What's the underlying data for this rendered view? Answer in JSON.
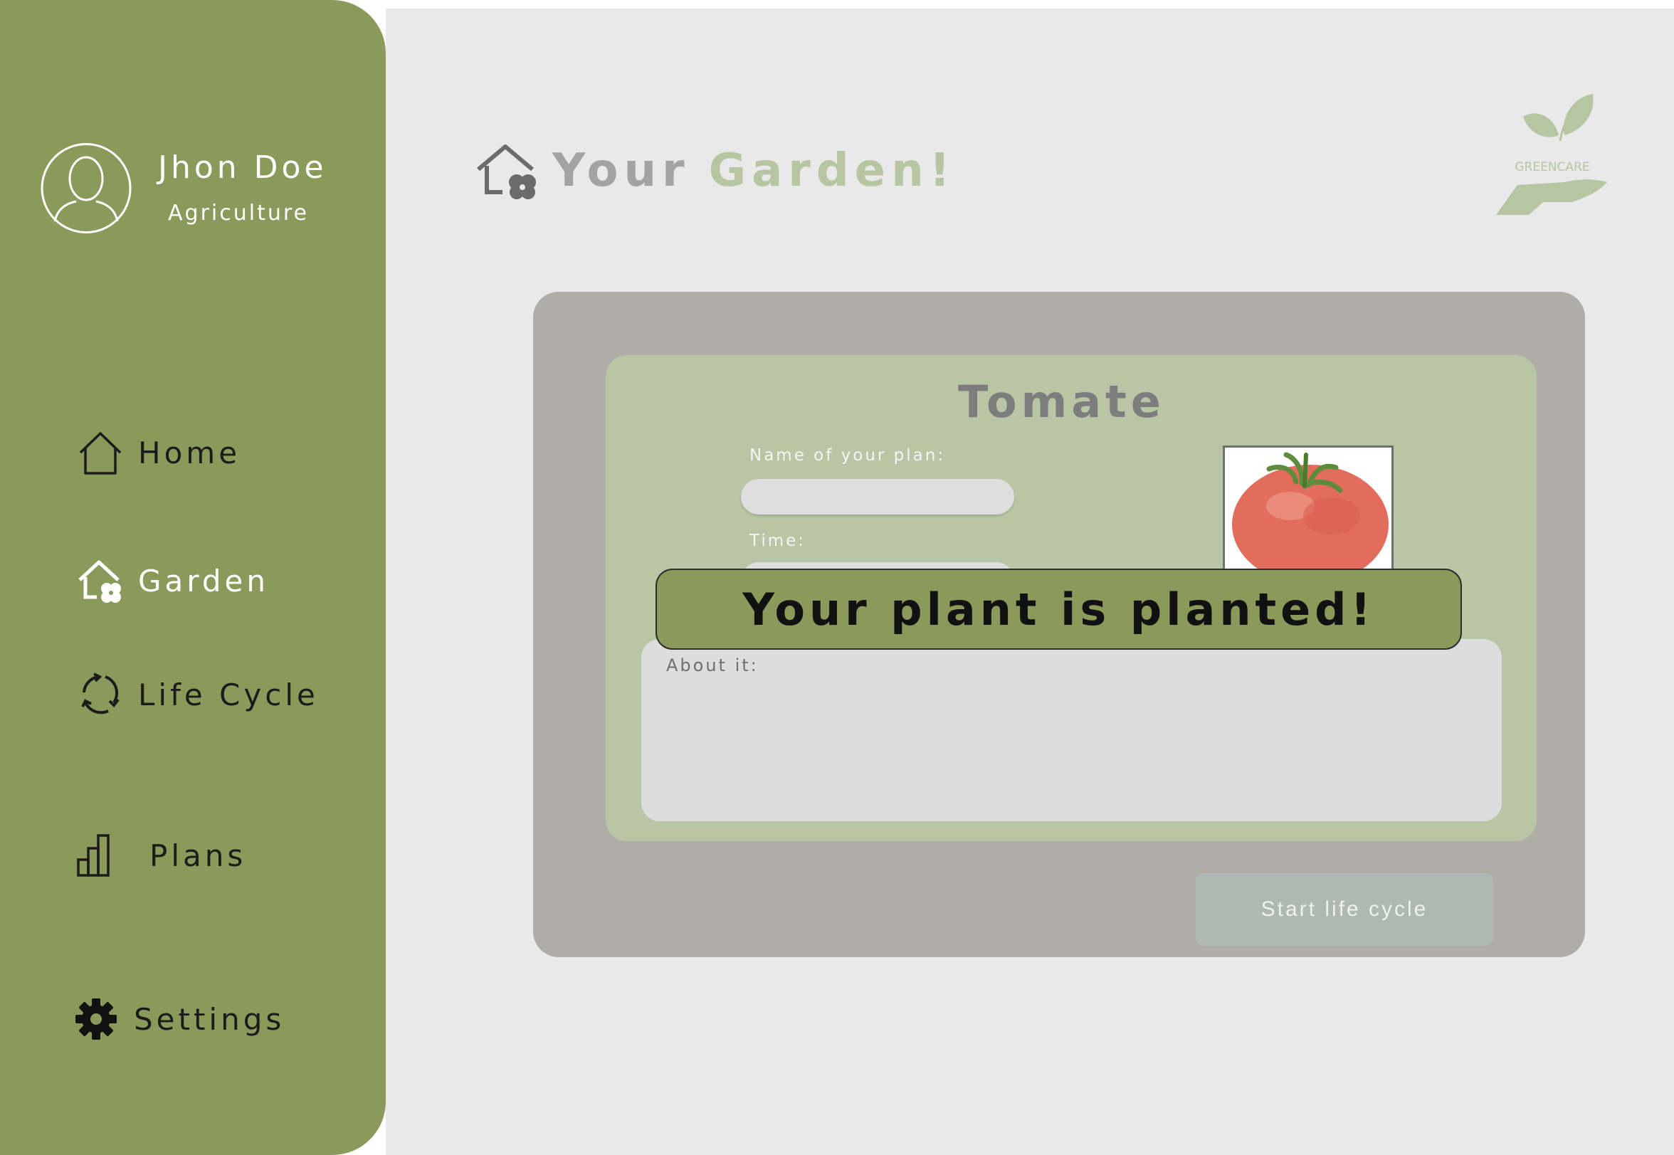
{
  "sidebar": {
    "user_name": "Jhon Doe",
    "user_role": "Agriculture",
    "items": [
      {
        "label": "Home",
        "icon": "home-icon"
      },
      {
        "label": "Garden",
        "icon": "garden-house-icon"
      },
      {
        "label": "Life Cycle",
        "icon": "recycle-icon"
      },
      {
        "label": "Plans",
        "icon": "bar-chart-icon"
      },
      {
        "label": "Settings",
        "icon": "gear-icon"
      }
    ]
  },
  "header": {
    "title_part1": "Your",
    "title_part2": "Garden!",
    "logo_text": "GREENCARE"
  },
  "card": {
    "plant_name": "Tomate",
    "name_label": "Name of your plan:",
    "name_value": "",
    "time_label": "Time:",
    "time_value": "",
    "about_label": "About it:",
    "button_label": "Start life cycle"
  },
  "toast": {
    "message": "Your plant is planted!"
  },
  "colors": {
    "sidebar": "#8a9a5a",
    "background": "#e9e9e9",
    "outer_card": "#b0aca6",
    "inner_card": "#b8c6a5",
    "button": "#adb9b2",
    "accent_title": "#b6c5a2"
  }
}
